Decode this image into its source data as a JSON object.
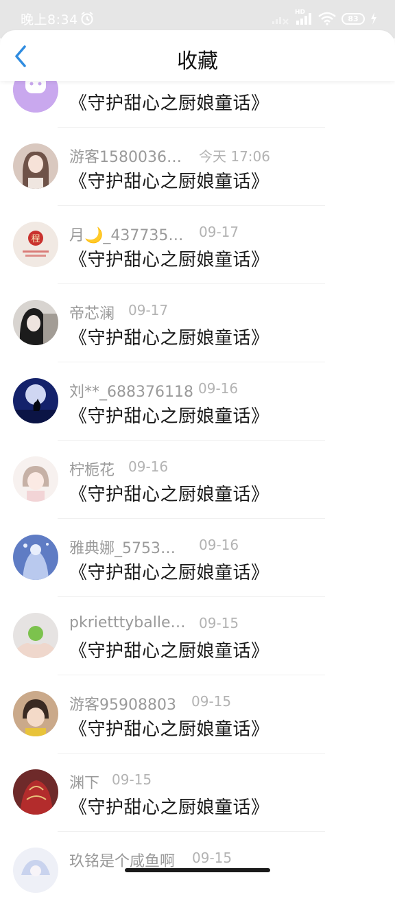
{
  "status_bar": {
    "time": "晚上8:34",
    "battery": "83",
    "network_label": "HD"
  },
  "header": {
    "title": "收藏"
  },
  "items": [
    {
      "username": "",
      "time": "",
      "title": "《守护甜心之厨娘童话》"
    },
    {
      "username": "游客1580036…",
      "time": "今天 17:06",
      "title": "《守护甜心之厨娘童话》"
    },
    {
      "username": "月🌙_437735…",
      "time": "09-17",
      "title": "《守护甜心之厨娘童话》"
    },
    {
      "username": "帝芯澜",
      "time": "09-17",
      "title": "《守护甜心之厨娘童话》"
    },
    {
      "username": "刘**_688376118",
      "time": "09-16",
      "title": "《守护甜心之厨娘童话》"
    },
    {
      "username": "柠栀花",
      "time": "09-16",
      "title": "《守护甜心之厨娘童话》"
    },
    {
      "username": "雅典娜_5753…",
      "time": "09-16",
      "title": "《守护甜心之厨娘童话》"
    },
    {
      "username": "pkrietttyballe…",
      "time": "09-15",
      "title": "《守护甜心之厨娘童话》"
    },
    {
      "username": "游客95908803",
      "time": "09-15",
      "title": "《守护甜心之厨娘童话》"
    },
    {
      "username": "渊下",
      "time": "09-15",
      "title": "《守护甜心之厨娘童话》"
    },
    {
      "username": "玖铭是个咸鱼啊",
      "time": "09-15",
      "title": ""
    }
  ],
  "colors": {
    "accent": "#2f8ce0",
    "status_bar_bg": "#e6e6e6"
  }
}
